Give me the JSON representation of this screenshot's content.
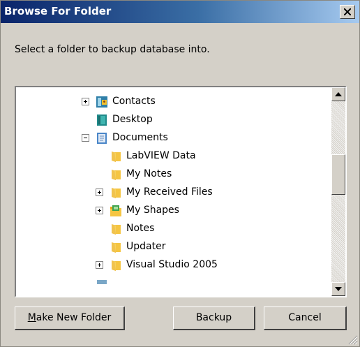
{
  "dialog": {
    "title": "Browse For Folder",
    "prompt": "Select a folder to backup database into."
  },
  "tree": {
    "items": [
      {
        "label": "Contacts",
        "icon": "contacts-icon",
        "expander": "+"
      },
      {
        "label": "Desktop",
        "icon": "desktop-icon",
        "expander": ""
      },
      {
        "label": "Documents",
        "icon": "documents-icon",
        "expander": "-"
      },
      {
        "label": "LabVIEW Data",
        "icon": "folder-icon",
        "expander": ""
      },
      {
        "label": "My Notes",
        "icon": "folder-icon",
        "expander": ""
      },
      {
        "label": "My Received Files",
        "icon": "folder-icon",
        "expander": "+"
      },
      {
        "label": "My Shapes",
        "icon": "shapes-folder-icon",
        "expander": "+"
      },
      {
        "label": "Notes",
        "icon": "folder-icon",
        "expander": ""
      },
      {
        "label": "Updater",
        "icon": "folder-icon",
        "expander": ""
      },
      {
        "label": "Visual Studio 2005",
        "icon": "folder-icon",
        "expander": "+"
      }
    ]
  },
  "buttons": {
    "make_new_folder_mnemonic": "M",
    "make_new_folder_rest": "ake New Folder",
    "backup": "Backup",
    "cancel": "Cancel"
  },
  "colors": {
    "title_gradient_start": "#0a246a",
    "title_gradient_end": "#a6caf0",
    "dialog_face": "#d4d0c8",
    "folder_yellow": "#f5c542"
  }
}
